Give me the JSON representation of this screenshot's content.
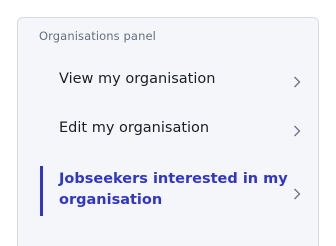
{
  "panel": {
    "title": "Organisations panel",
    "accent_color": "#3136c9",
    "items": [
      {
        "label": "View my organisation",
        "icon": "chevron-right-icon",
        "active": false
      },
      {
        "label": "Edit my organisation",
        "icon": "chevron-right-icon",
        "active": false
      },
      {
        "label": "Jobseekers interested in my organisation",
        "icon": "chevron-right-icon",
        "active": true
      }
    ]
  }
}
